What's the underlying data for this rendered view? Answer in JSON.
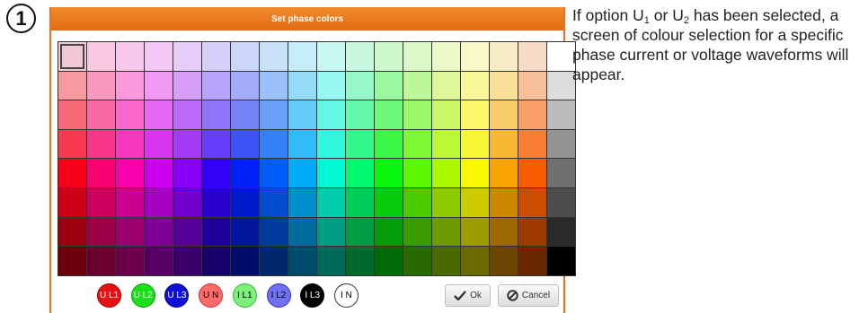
{
  "step": "1",
  "dialog": {
    "title": "Set phase colors",
    "accent": "#e8731f",
    "palette_rows": [
      [
        "#f0c8d8",
        "#f8c8e0",
        "#f8c8ec",
        "#f4c8f4",
        "#e6cdf8",
        "#d6d0f8",
        "#cbd6f8",
        "#c8e0f8",
        "#c6eef8",
        "#c8f8f4",
        "#c8f8e0",
        "#ccf8cc",
        "#dcf8c8",
        "#ecf8c8",
        "#f8f8c8",
        "#f8ecc8",
        "#f8dcc8",
        "#ffffff"
      ],
      [
        "#f89ba0",
        "#f89ac0",
        "#f89adc",
        "#f09af6",
        "#d6a0f8",
        "#b8a4f8",
        "#a4acf8",
        "#9cc0f8",
        "#94dcf8",
        "#96f8f0",
        "#96f8c8",
        "#9cf8a0",
        "#bcf89a",
        "#dcf89a",
        "#f8f89a",
        "#f8e09a",
        "#f8c09a",
        "#dcdcdc"
      ],
      [
        "#f86a78",
        "#f868a4",
        "#f868cc",
        "#e468f4",
        "#bc6cf8",
        "#8e74f8",
        "#7484f8",
        "#68a0f8",
        "#64ccf8",
        "#64f8e6",
        "#64f8aa",
        "#6ef878",
        "#9cf868",
        "#ccf868",
        "#f8f868",
        "#f8cc68",
        "#f8a068",
        "#bcbcbc"
      ],
      [
        "#f83850",
        "#f8368a",
        "#f836bc",
        "#d836f0",
        "#a23af6",
        "#643ef8",
        "#3e54f8",
        "#3480f8",
        "#30bcf8",
        "#30f8dc",
        "#30f88c",
        "#3cf846",
        "#7cf834",
        "#bcf834",
        "#f8f834",
        "#f8b834",
        "#f87e34",
        "#949494"
      ],
      [
        "#f80018",
        "#f80070",
        "#f800ac",
        "#ca00ec",
        "#8800f6",
        "#3400f8",
        "#0020f8",
        "#005cf8",
        "#00acf8",
        "#00f8d2",
        "#00f86e",
        "#08f810",
        "#5cf800",
        "#acf800",
        "#f8f800",
        "#f8a400",
        "#f85c00",
        "#707070"
      ],
      [
        "#cc0014",
        "#cc005c",
        "#cc008e",
        "#a600c2",
        "#7000ca",
        "#2a00cc",
        "#001acc",
        "#004ccc",
        "#008ecc",
        "#00ccac",
        "#00cc5a",
        "#06cc0c",
        "#4ccc00",
        "#8ecc00",
        "#cccc00",
        "#cc8700",
        "#cc4c00",
        "#4c4c4c"
      ],
      [
        "#9c0010",
        "#9c0046",
        "#9c006c",
        "#7e0094",
        "#56009a",
        "#20009c",
        "#00149c",
        "#003a9c",
        "#006c9c",
        "#009c84",
        "#009c44",
        "#049c0a",
        "#3a9c00",
        "#6c9c00",
        "#9c9c00",
        "#9c6800",
        "#9c3a00",
        "#2a2a2a"
      ],
      [
        "#6a000a",
        "#6a0030",
        "#6a004a",
        "#560064",
        "#3a0068",
        "#16006a",
        "#000e6a",
        "#00286a",
        "#004a6a",
        "#006a5a",
        "#006a2e",
        "#026a06",
        "#286a00",
        "#4a6a00",
        "#6a6a00",
        "#6a4600",
        "#6a2800",
        "#000000"
      ]
    ],
    "phase_buttons": [
      {
        "label": "U L1",
        "fill": "#e81010",
        "text": "#ffffff",
        "border": "#a00000"
      },
      {
        "label": "U L2",
        "fill": "#19e019",
        "text": "#ffffff",
        "border": "#0a9a0a"
      },
      {
        "label": "U L3",
        "fill": "#1010d8",
        "text": "#ffffff",
        "border": "#000090"
      },
      {
        "label": "U N",
        "fill": "#ff6b6b",
        "text": "#000000",
        "border": "#d03030"
      },
      {
        "label": "I L1",
        "fill": "#7cf07c",
        "text": "#000000",
        "border": "#2fb82f"
      },
      {
        "label": "I L2",
        "fill": "#7070f0",
        "text": "#000000",
        "border": "#3333b0"
      },
      {
        "label": "I L3",
        "fill": "#000000",
        "text": "#ffffff",
        "border": "#000000"
      },
      {
        "label": "I N",
        "fill": "#ffffff",
        "text": "#000000",
        "border": "#333333"
      }
    ],
    "ok_label": "Ok",
    "cancel_label": "Cancel"
  },
  "caption": {
    "part1": "If option U",
    "sub1": "1",
    "part2": " or U",
    "sub2": "2",
    "part3": " has been selected, a screen of colour selection for a specific phase current or voltage waveforms will appear."
  }
}
